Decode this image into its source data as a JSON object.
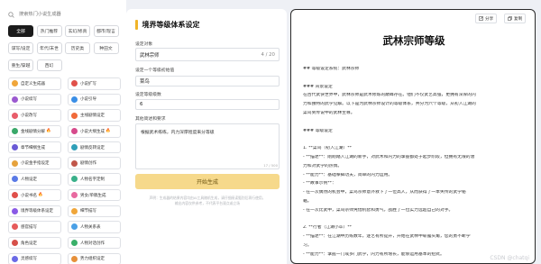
{
  "search": {
    "placeholder": "搜索热门小说生成器"
  },
  "categories": [
    "全部",
    "热门推荐",
    "玄幻/修真",
    "都市/现言",
    "谋写/设定",
    "年代/末世",
    "历史类",
    "种田文",
    "重生/穿越",
    "西幻"
  ],
  "tools": [
    {
      "label": "自定义生成器",
      "color": "#f0a63a",
      "hot": false
    },
    {
      "label": "小说扩写",
      "color": "#e0504a",
      "hot": false
    },
    {
      "label": "小说续写",
      "color": "#9b59d0",
      "hot": false
    },
    {
      "label": "小说引导",
      "color": "#3a8ee6",
      "hot": false
    },
    {
      "label": "小说改写",
      "color": "#e85d6a",
      "hot": false
    },
    {
      "label": "主线剧情设定",
      "color": "#f06a3a",
      "hot": false
    },
    {
      "label": "金线剧情分解",
      "color": "#3aa86a",
      "hot": true
    },
    {
      "label": "小说大纲生成",
      "color": "#d64a8c",
      "hot": true
    },
    {
      "label": "章节细纲生成",
      "color": "#6a5ad6",
      "hot": false
    },
    {
      "label": "剧情反转设定",
      "color": "#2f9fb8",
      "hot": false
    },
    {
      "label": "小说金手指设定",
      "color": "#e6a23c",
      "hot": false
    },
    {
      "label": "剧情创作",
      "color": "#c0564a",
      "hot": false
    },
    {
      "label": "人物设定",
      "color": "#5a7ae6",
      "hot": false
    },
    {
      "label": "人物名字定制",
      "color": "#3ab08a",
      "hot": false
    },
    {
      "label": "小说书名",
      "color": "#e0504a",
      "hot": true
    },
    {
      "label": "男女/单稿生成",
      "color": "#e86aa0",
      "hot": false
    },
    {
      "label": "境界等级体系设定",
      "color": "#8a5ae6",
      "hot": false
    },
    {
      "label": "细节描写",
      "color": "#f0a63a",
      "hot": false
    },
    {
      "label": "感官描写",
      "color": "#e65a5a",
      "hot": false
    },
    {
      "label": "人物关系表",
      "color": "#4aa0e6",
      "hot": false
    },
    {
      "label": "角色设定",
      "color": "#d6504a",
      "hot": false
    },
    {
      "label": "人物对话创作",
      "color": "#3ab06a",
      "hot": false
    },
    {
      "label": "灵感续写",
      "color": "#6a6ae6",
      "hot": false
    },
    {
      "label": "势力组织设定",
      "color": "#e6903a",
      "hot": false
    }
  ],
  "form": {
    "title": "境界等级体系设定",
    "object_label": "设定对象",
    "object_value": "武林宗师",
    "object_count": "4 / 20",
    "level_label": "设定一个等级初始值",
    "level_value": "菜鸟",
    "count_label": "设定等级级数",
    "count_value": "6",
    "desc_label": "其他简述和要求",
    "desc_value": "根据武术练练，内力深厚程度来分等级",
    "desc_count": "17 / 500",
    "generate_label": "开始生成",
    "note_line1": "声明：生成器的结果内容均由AI工具随机生成，请仔细阅读甄别后再行使用，",
    "note_line2": "输出内容仅供参考，不代表平台观点或立场"
  },
  "result": {
    "share_label": "分享",
    "copy_label": "复制",
    "title": "武林宗师等级",
    "lines": [
      "## 等级设定系统：武林宗师",
      "",
      "### 背景设定",
      "在古代武侠世界中，武林宗师是武术修炼的巅峰存在。他们不仅武艺高强，更拥有深厚的内",
      "力和独特的武学见解。以下是为武林宗师设计的等级体系，共分为六个等级，从初入江湖的",
      "菜鸟到传说中的武林至尊。",
      "",
      "### 等级设定",
      "",
      "1. **菜鸟（初入江湖）**",
      "   - **描述**：刚刚踏入江湖的新手，对武术和内力的掌握都处于起步阶段，但拥有无限的潜",
      "力和对武学的热情。",
      "   - **能力**：基础拳脚功夫，简单的内力运用。",
      "   - **故事示例**：",
      "     - 在一次偶然的机会中，菜鸟宗师意外救下了一位高人，从而获得了一本失传的武学秘",
      "籍。",
      "     - 在一次比武中，菜鸟宗师凭借机智和勇气，战胜了一位实力远超自己的对手。",
      "",
      "2. **行者（江湖小卒）**",
      "   - **描述**：在江湖中历练数年，逐艺有所提升，开始在武林中崭露头角，您的勇不断学",
      "习。",
      "   - **能力**：掌握一门或多门武学，内力有所增长，能够运用基本的招式。"
    ],
    "watermark": "CSDN @chatqi"
  }
}
